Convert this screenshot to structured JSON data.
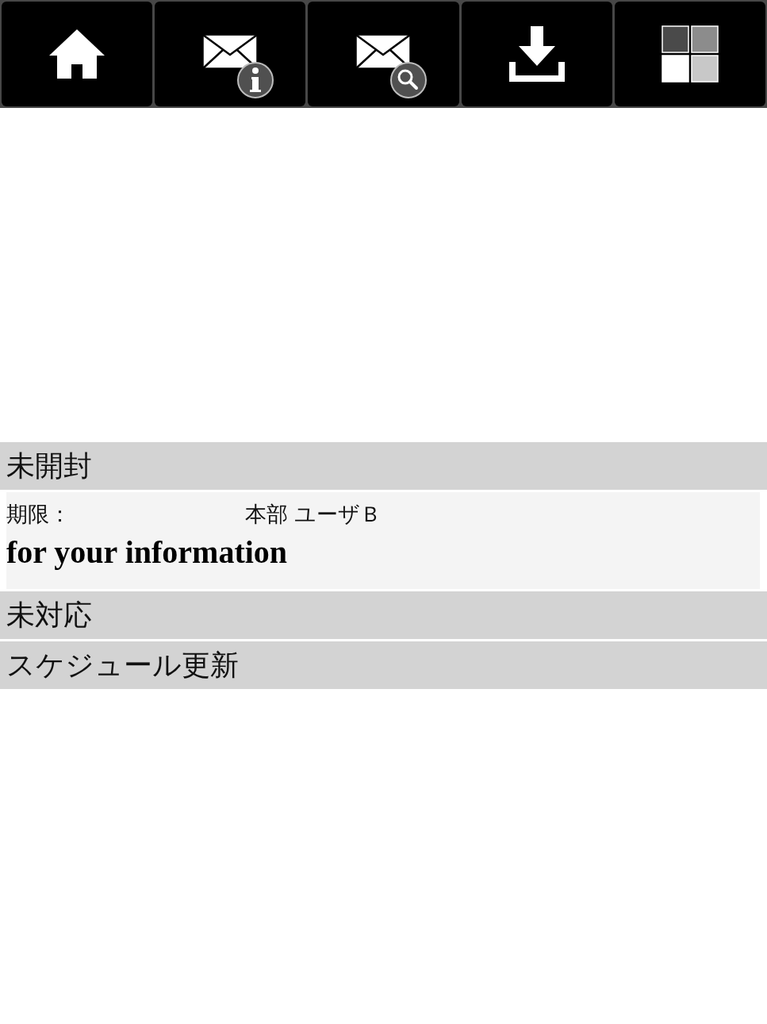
{
  "toolbar": {
    "buttons": [
      {
        "kind": "home"
      },
      {
        "kind": "mail_info"
      },
      {
        "kind": "mail_search"
      },
      {
        "kind": "download"
      },
      {
        "kind": "tiles"
      }
    ]
  },
  "sections": [
    {
      "title": "未開封",
      "items": [
        {
          "deadline_label": "期限：",
          "sender": "本部 ユーザＢ",
          "subject": "for your information"
        }
      ]
    },
    {
      "title": "未対応"
    },
    {
      "title": "スケジュール更新"
    }
  ]
}
